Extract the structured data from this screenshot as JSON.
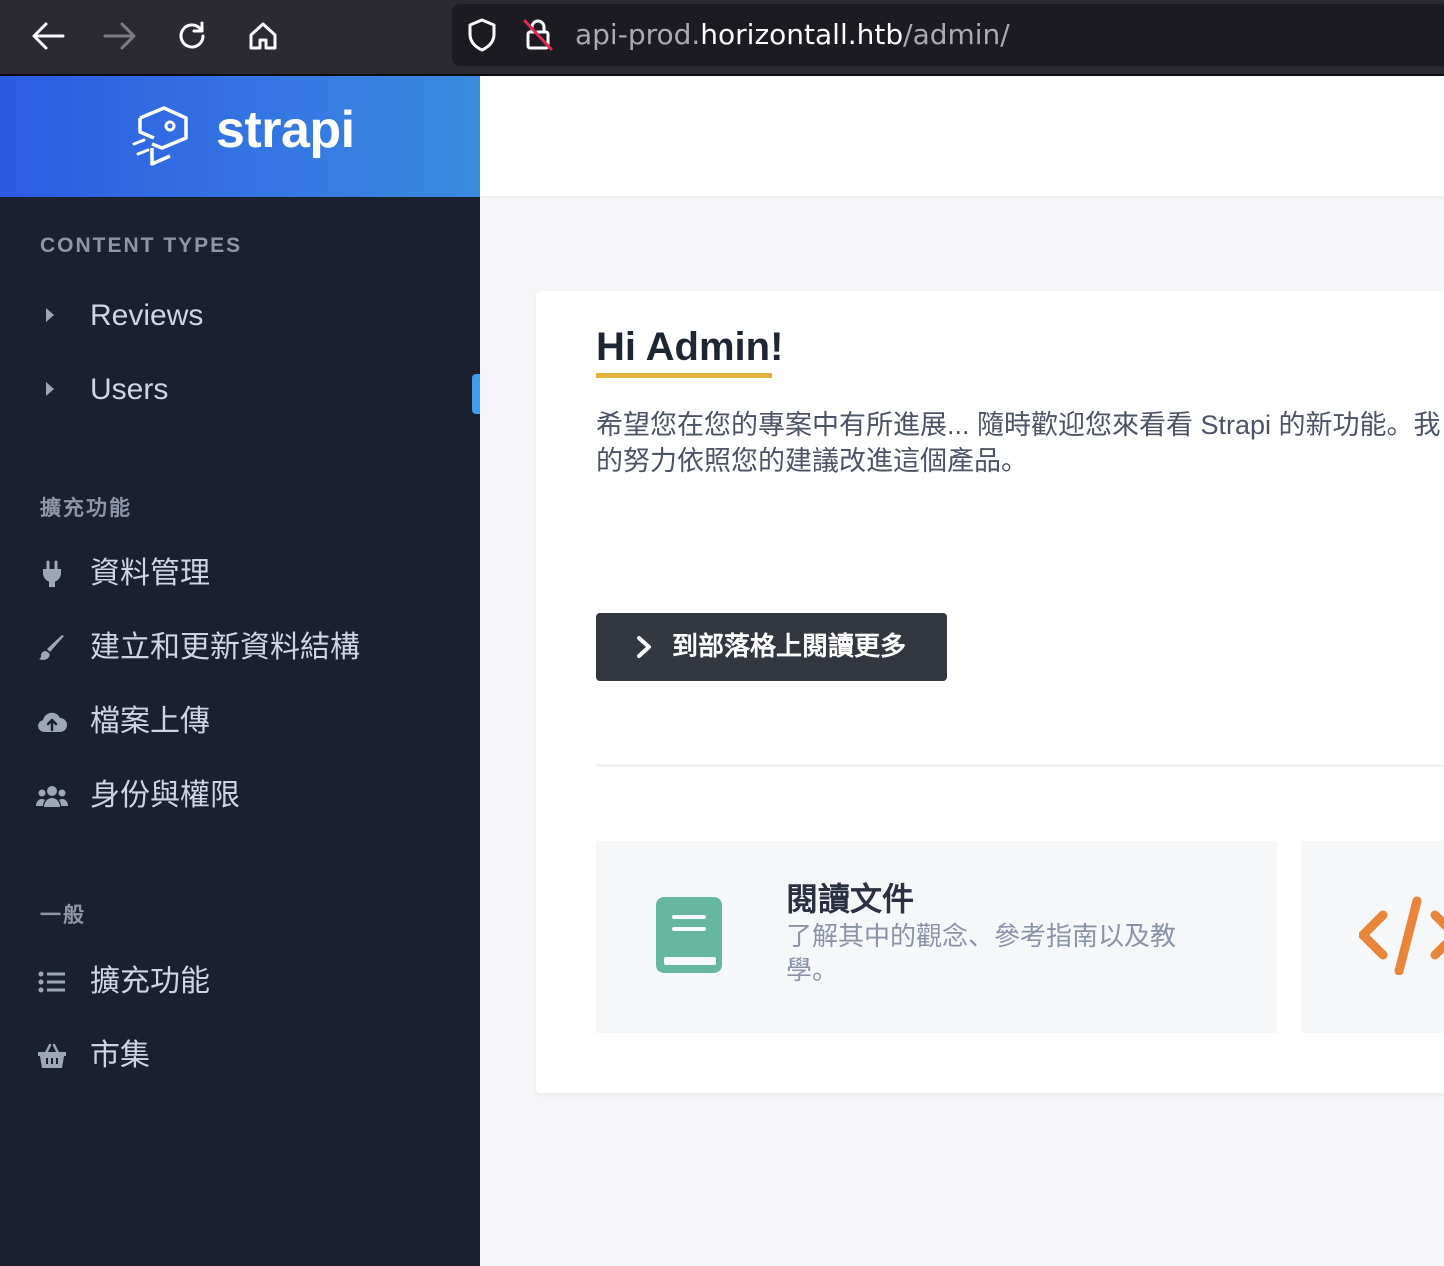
{
  "browser": {
    "url_prefix": "api-prod.",
    "url_host": "horizontall.htb",
    "url_path": "/admin/"
  },
  "brand": {
    "name": "strapi"
  },
  "sidebar": {
    "sections": [
      {
        "title": "CONTENT TYPES",
        "items": [
          {
            "label": "Reviews",
            "icon": "caret-right-icon"
          },
          {
            "label": "Users",
            "icon": "caret-right-icon"
          }
        ]
      },
      {
        "title": "擴充功能",
        "items": [
          {
            "label": "資料管理",
            "icon": "plug-icon"
          },
          {
            "label": "建立和更新資料結構",
            "icon": "paint-brush-icon"
          },
          {
            "label": "檔案上傳",
            "icon": "cloud-upload-icon"
          },
          {
            "label": "身份與權限",
            "icon": "users-icon"
          }
        ]
      },
      {
        "title": "一般",
        "items": [
          {
            "label": "擴充功能",
            "icon": "list-icon"
          },
          {
            "label": "市集",
            "icon": "shopping-basket-icon"
          }
        ]
      }
    ]
  },
  "main": {
    "greeting": "Hi Admin!",
    "welcome_line1": "希望您在您的專案中有所進展... 隨時歡迎您來看看 Strapi 的新功能。我",
    "welcome_line2": "的努力依照您的建議改進這個產品。",
    "cta_label": "到部落格上閱讀更多",
    "tiles": [
      {
        "title": "閱讀文件",
        "description": "了解其中的觀念、參考指南以及教學。",
        "icon": "book-icon",
        "color": "#66b7a0"
      },
      {
        "title": "",
        "description": "",
        "icon": "code-icon",
        "color": "#e8853a"
      }
    ]
  },
  "colors": {
    "accent_blue": "#2d5be3",
    "sidebar_bg": "#1b202f",
    "underline_gold": "#e2b43f",
    "button_dark": "#333740"
  }
}
